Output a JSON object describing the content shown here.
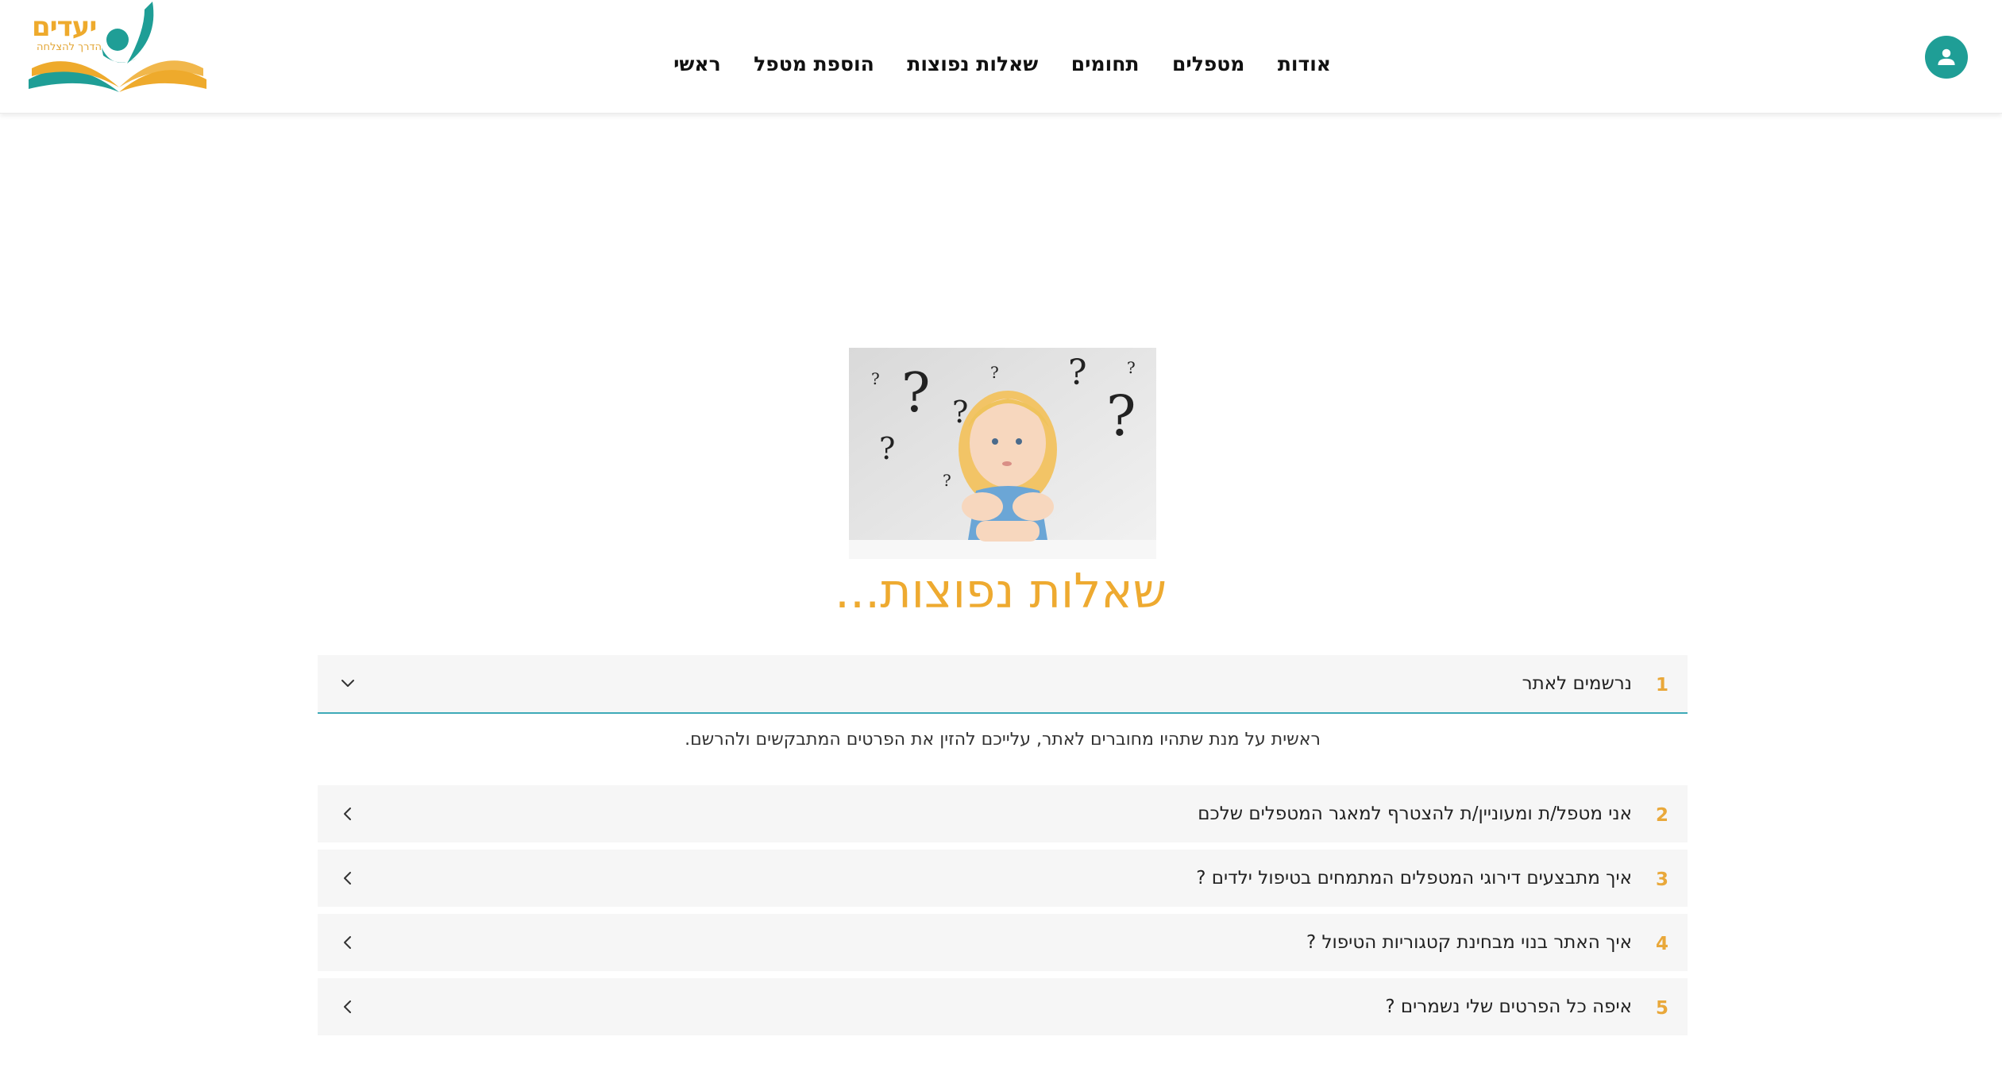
{
  "header": {
    "logo": {
      "name": "יעדים",
      "tagline": "הדרך להצלחה",
      "colors": {
        "orange": "#eeaa2c",
        "teal": "#1f9e96"
      }
    },
    "nav": [
      {
        "label": "ראשי"
      },
      {
        "label": "הוספת מטפל"
      },
      {
        "label": "שאלות נפוצות"
      },
      {
        "label": "תחומים"
      },
      {
        "label": "מטפלים"
      },
      {
        "label": "אודות"
      }
    ],
    "user_icon": "user-icon"
  },
  "hero": {
    "image_icon": "child-thinking-question-marks-image",
    "title": "שאלות נפוצות..."
  },
  "faq": {
    "items": [
      {
        "number": "1",
        "question": "נרשמים לאתר",
        "open": true,
        "answer": "ראשית על מנת שתהיו מחוברים לאתר, עלייכם להזין את הפרטים המתבקשים ולהרשם."
      },
      {
        "number": "2",
        "question": "אני מטפל/ת ומעוניין/ת להצטרף למאגר המטפלים שלכם",
        "open": false
      },
      {
        "number": "3",
        "question": "איך מתבצעים דירוגי המטפלים המתמחים בטיפול ילדים ?",
        "open": false
      },
      {
        "number": "4",
        "question": "איך האתר בנוי מבחינת קטגוריות הטיפול ?",
        "open": false
      },
      {
        "number": "5",
        "question": "איפה כל הפרטים שלי נשמרים ?",
        "open": false
      }
    ]
  },
  "colors": {
    "accent_orange": "#eeaa30",
    "accent_teal": "#1f9e96",
    "row_background": "#f6f6f6",
    "open_border": "#3eaab8"
  }
}
